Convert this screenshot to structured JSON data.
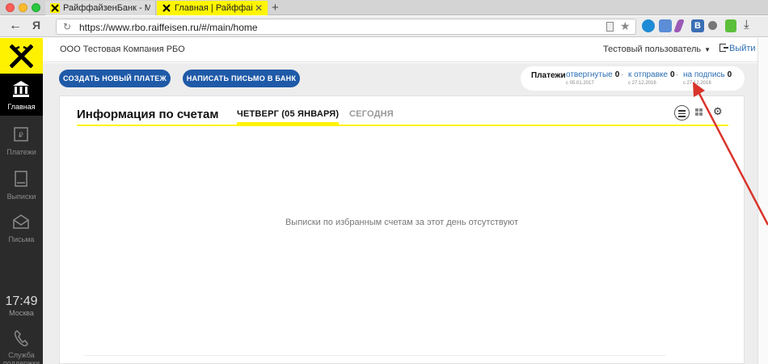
{
  "browser": {
    "tabs": [
      {
        "title": "РайффайзенБанк - Малое",
        "active": false
      },
      {
        "title": "Главная | Райффайзенбан",
        "active": true
      }
    ],
    "new_tab": "+",
    "url": "https://www.rbo.raiffeisen.ru/#/main/home",
    "yandex_label": "Я",
    "back_glyph": "←",
    "extensions": {
      "vk": "В"
    }
  },
  "sidebar": {
    "items": [
      {
        "label": "Главная",
        "icon": "bank-icon",
        "active": true
      },
      {
        "label": "Платежи",
        "icon": "payment-icon",
        "active": false
      },
      {
        "label": "Выписки",
        "icon": "statement-icon",
        "active": false
      },
      {
        "label": "Письма",
        "icon": "mail-icon",
        "active": false
      }
    ],
    "clock": {
      "time": "17:49",
      "city": "Москва"
    },
    "support": {
      "label": "Служба поддержки",
      "icon": "phone-icon"
    }
  },
  "header": {
    "company": "ООО Тестовая Компания РБО",
    "user": "Тестовый пользователь",
    "logout": "Выйти"
  },
  "actions": {
    "new_payment": "СОЗДАТЬ НОВЫЙ ПЛАТЕЖ",
    "write_bank": "НАПИСАТЬ ПИСЬМО В БАНК"
  },
  "payments_widget": {
    "title": "Платежи",
    "groups": [
      {
        "label": "отвергнутые",
        "count": "0",
        "since": "с 05.01.2017"
      },
      {
        "label": "к отправке",
        "count": "0",
        "since": "с 27.12.2016"
      },
      {
        "label": "на подпись",
        "count": "0",
        "since": "с 27.12.2016"
      }
    ],
    "separator": "·"
  },
  "accounts_card": {
    "title": "Информация по счетам",
    "tabs": [
      {
        "label": "ЧЕТВЕРГ (05 ЯНВАРЯ)",
        "active": true
      },
      {
        "label": "СЕГОДНЯ",
        "active": false
      }
    ],
    "empty_message": "Выписки по избранным счетам за этот день отсутствуют"
  },
  "colors": {
    "brand_yellow": "#fff200",
    "button_blue": "#1f5aa8",
    "link_blue": "#2a6db3",
    "sidebar_dark": "#2b2b2b",
    "annotation_red": "#d9342b"
  }
}
